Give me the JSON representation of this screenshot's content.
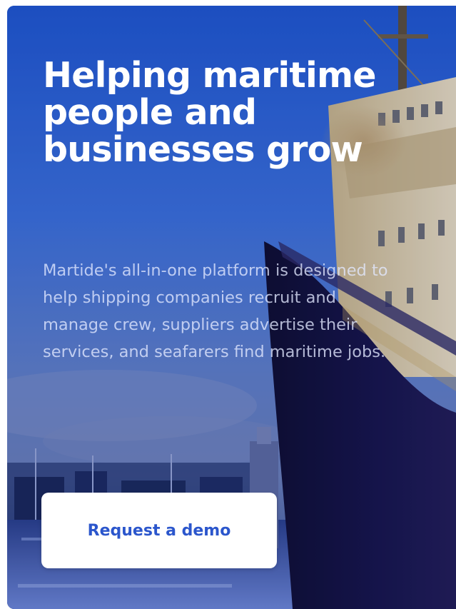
{
  "hero": {
    "headline": "Helping maritime people and businesses grow",
    "description": "Martide's all-in-one platform is designed to help shipping companies recruit and manage crew, suppliers advertise their services, and seafarers find maritime jobs.",
    "cta_label": "Request a demo"
  },
  "colors": {
    "sky_top": "#2f63d6",
    "sky_bottom": "#4a6fc9",
    "hull": "#15123a",
    "button_text": "#2b56cc"
  },
  "background_image": "ship-at-port-dusk"
}
